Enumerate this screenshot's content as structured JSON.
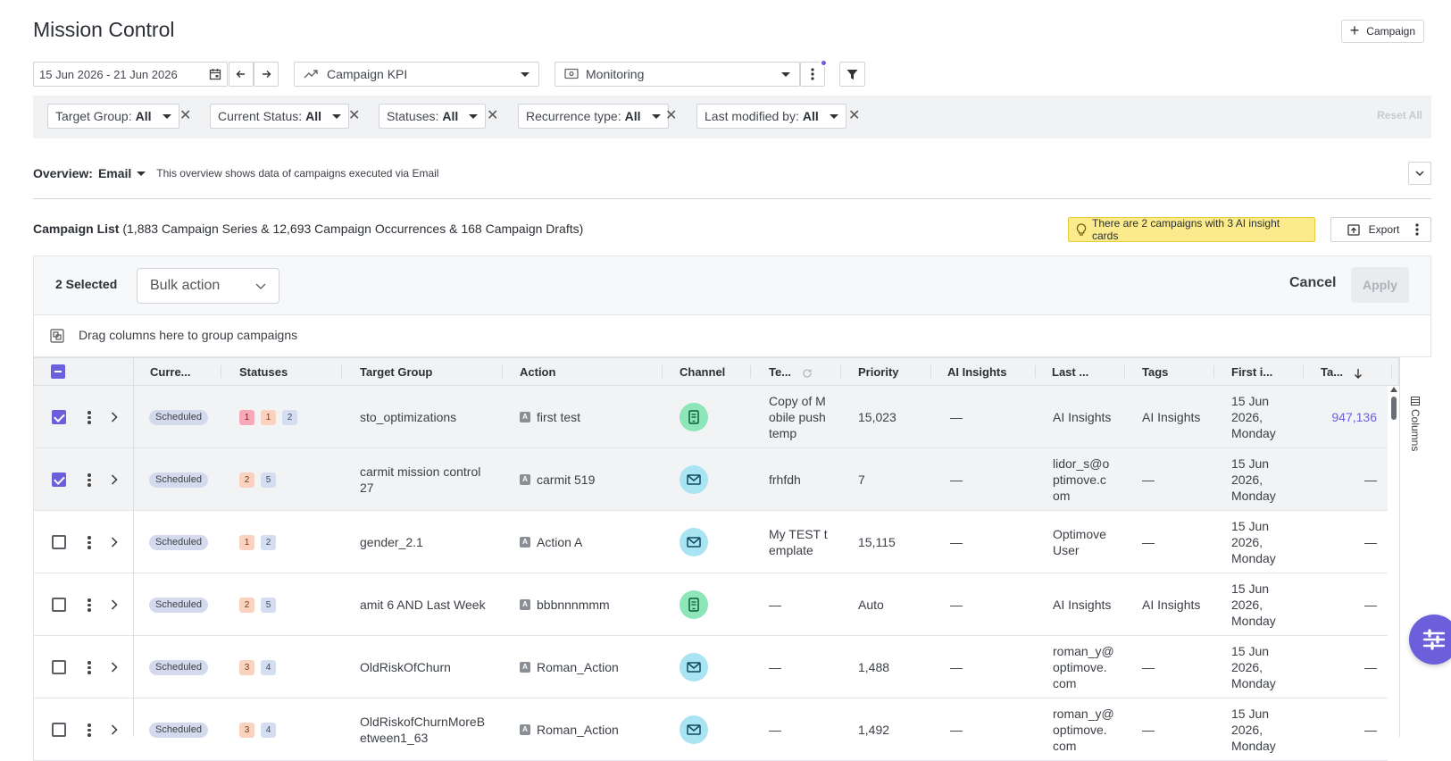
{
  "header": {
    "title": "Mission Control",
    "add_campaign_label": "Campaign"
  },
  "controls": {
    "date_range": "15 Jun 2026 - 21 Jun 2026",
    "kpi": "Campaign KPI",
    "view": "Monitoring"
  },
  "filters": [
    {
      "label": "Target Group:",
      "value": "All"
    },
    {
      "label": "Current Status:",
      "value": "All"
    },
    {
      "label": "Statuses:",
      "value": "All"
    },
    {
      "label": "Recurrence type:",
      "value": "All"
    },
    {
      "label": "Last modified by:",
      "value": "All"
    }
  ],
  "reset_all": "Reset All",
  "overview": {
    "label": "Overview:",
    "value": "Email",
    "description": "This overview shows data of campaigns executed via Email"
  },
  "campaign_list": {
    "title": "Campaign List",
    "summary": "(1,883 Campaign Series & 12,693 Campaign Occurrences & 168 Campaign Drafts)",
    "ai_banner": "There are 2 campaigns with 3 AI insight cards",
    "export_label": "Export"
  },
  "bulk": {
    "selected": "2 Selected",
    "action_placeholder": "Bulk action",
    "cancel": "Cancel",
    "apply": "Apply"
  },
  "group_bar": "Drag columns here to group campaigns",
  "columns": [
    "Curre...",
    "Statuses",
    "Target Group",
    "Action",
    "Channel",
    "Te...",
    "Priority",
    "AI Insights",
    "Last ...",
    "Tags",
    "First i...",
    "Ta..."
  ],
  "columns_panel_label": "Columns",
  "rows": [
    {
      "checked": true,
      "status": "Scheduled",
      "counts": [
        [
          "1",
          "red"
        ],
        [
          "1",
          "org"
        ],
        [
          "2",
          "blu"
        ]
      ],
      "target_group": [
        "sto_optimizations"
      ],
      "action": "first test",
      "channel": "mobile",
      "template": [
        "Copy of M",
        "obile push",
        "temp"
      ],
      "priority": "15,023",
      "ai_insights": "—",
      "last_modified": [
        "AI Insights"
      ],
      "tags": "AI Insights",
      "first_in": [
        "15 Jun",
        "2026,",
        "Monday"
      ],
      "target": "947,136"
    },
    {
      "checked": true,
      "status": "Scheduled",
      "counts": [
        [
          "2",
          "org"
        ],
        [
          "5",
          "blu"
        ]
      ],
      "target_group": [
        "carmit mission control",
        "27"
      ],
      "action": "carmit 519",
      "channel": "email",
      "template": [
        "frhfdh"
      ],
      "priority": "7",
      "ai_insights": "—",
      "last_modified": [
        "lidor_s@o",
        "ptimove.c",
        "om"
      ],
      "tags": "—",
      "first_in": [
        "15 Jun",
        "2026,",
        "Monday"
      ],
      "target": "—"
    },
    {
      "checked": false,
      "status": "Scheduled",
      "counts": [
        [
          "1",
          "org"
        ],
        [
          "2",
          "blu"
        ]
      ],
      "target_group": [
        "gender_2.1"
      ],
      "action": "Action A",
      "channel": "email",
      "template": [
        "My TEST t",
        "emplate"
      ],
      "priority": "15,115",
      "ai_insights": "—",
      "last_modified": [
        "Optimove",
        "User"
      ],
      "tags": "—",
      "first_in": [
        "15 Jun",
        "2026,",
        "Monday"
      ],
      "target": "—"
    },
    {
      "checked": false,
      "status": "Scheduled",
      "counts": [
        [
          "2",
          "org"
        ],
        [
          "5",
          "blu"
        ]
      ],
      "target_group": [
        "amit 6 AND Last Week"
      ],
      "action": "bbbnnnmmm",
      "channel": "mobile",
      "template": [
        "—"
      ],
      "priority": "Auto",
      "ai_insights": "—",
      "last_modified": [
        "AI Insights"
      ],
      "tags": "AI Insights",
      "first_in": [
        "15 Jun",
        "2026,",
        "Monday"
      ],
      "target": "—"
    },
    {
      "checked": false,
      "status": "Scheduled",
      "counts": [
        [
          "3",
          "org"
        ],
        [
          "4",
          "blu"
        ]
      ],
      "target_group": [
        "OldRiskOfChurn"
      ],
      "action": "Roman_Action",
      "channel": "email",
      "template": [
        "—"
      ],
      "priority": "1,488",
      "ai_insights": "—",
      "last_modified": [
        "roman_y@",
        "optimove.",
        "com"
      ],
      "tags": "—",
      "first_in": [
        "15 Jun",
        "2026,",
        "Monday"
      ],
      "target": "—"
    },
    {
      "checked": false,
      "status": "Scheduled",
      "counts": [
        [
          "3",
          "org"
        ],
        [
          "4",
          "blu"
        ]
      ],
      "target_group": [
        "OldRiskofChurnMoreB",
        "etween1_63"
      ],
      "action": "Roman_Action",
      "channel": "email",
      "template": [
        "—"
      ],
      "priority": "1,492",
      "ai_insights": "—",
      "last_modified": [
        "roman_y@",
        "optimove.",
        "com"
      ],
      "tags": "—",
      "first_in": [
        "15 Jun",
        "2026,",
        "Monday"
      ],
      "target": "—"
    }
  ]
}
